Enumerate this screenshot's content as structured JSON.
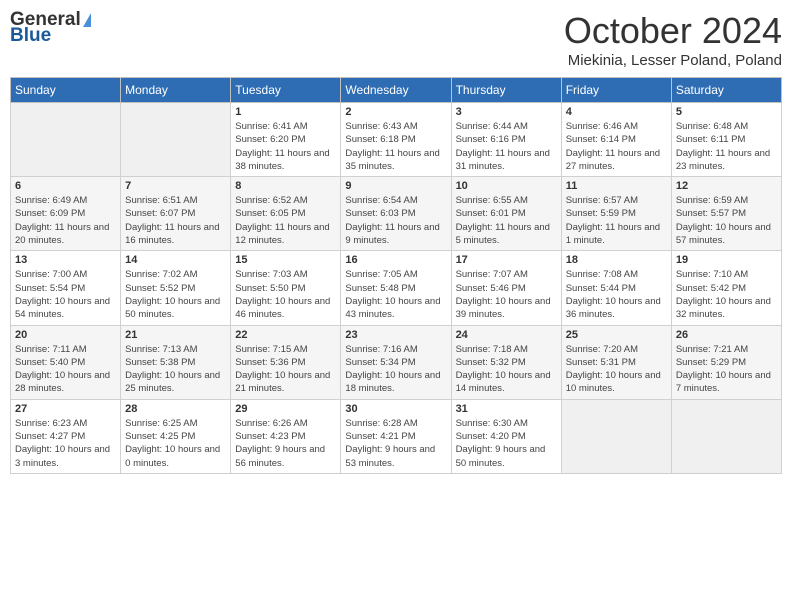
{
  "header": {
    "logo_general": "General",
    "logo_blue": "Blue",
    "month_title": "October 2024",
    "location": "Miekinia, Lesser Poland, Poland"
  },
  "days_of_week": [
    "Sunday",
    "Monday",
    "Tuesday",
    "Wednesday",
    "Thursday",
    "Friday",
    "Saturday"
  ],
  "weeks": [
    [
      {
        "day": "",
        "info": ""
      },
      {
        "day": "",
        "info": ""
      },
      {
        "day": "1",
        "info": "Sunrise: 6:41 AM\nSunset: 6:20 PM\nDaylight: 11 hours and 38 minutes."
      },
      {
        "day": "2",
        "info": "Sunrise: 6:43 AM\nSunset: 6:18 PM\nDaylight: 11 hours and 35 minutes."
      },
      {
        "day": "3",
        "info": "Sunrise: 6:44 AM\nSunset: 6:16 PM\nDaylight: 11 hours and 31 minutes."
      },
      {
        "day": "4",
        "info": "Sunrise: 6:46 AM\nSunset: 6:14 PM\nDaylight: 11 hours and 27 minutes."
      },
      {
        "day": "5",
        "info": "Sunrise: 6:48 AM\nSunset: 6:11 PM\nDaylight: 11 hours and 23 minutes."
      }
    ],
    [
      {
        "day": "6",
        "info": "Sunrise: 6:49 AM\nSunset: 6:09 PM\nDaylight: 11 hours and 20 minutes."
      },
      {
        "day": "7",
        "info": "Sunrise: 6:51 AM\nSunset: 6:07 PM\nDaylight: 11 hours and 16 minutes."
      },
      {
        "day": "8",
        "info": "Sunrise: 6:52 AM\nSunset: 6:05 PM\nDaylight: 11 hours and 12 minutes."
      },
      {
        "day": "9",
        "info": "Sunrise: 6:54 AM\nSunset: 6:03 PM\nDaylight: 11 hours and 9 minutes."
      },
      {
        "day": "10",
        "info": "Sunrise: 6:55 AM\nSunset: 6:01 PM\nDaylight: 11 hours and 5 minutes."
      },
      {
        "day": "11",
        "info": "Sunrise: 6:57 AM\nSunset: 5:59 PM\nDaylight: 11 hours and 1 minute."
      },
      {
        "day": "12",
        "info": "Sunrise: 6:59 AM\nSunset: 5:57 PM\nDaylight: 10 hours and 57 minutes."
      }
    ],
    [
      {
        "day": "13",
        "info": "Sunrise: 7:00 AM\nSunset: 5:54 PM\nDaylight: 10 hours and 54 minutes."
      },
      {
        "day": "14",
        "info": "Sunrise: 7:02 AM\nSunset: 5:52 PM\nDaylight: 10 hours and 50 minutes."
      },
      {
        "day": "15",
        "info": "Sunrise: 7:03 AM\nSunset: 5:50 PM\nDaylight: 10 hours and 46 minutes."
      },
      {
        "day": "16",
        "info": "Sunrise: 7:05 AM\nSunset: 5:48 PM\nDaylight: 10 hours and 43 minutes."
      },
      {
        "day": "17",
        "info": "Sunrise: 7:07 AM\nSunset: 5:46 PM\nDaylight: 10 hours and 39 minutes."
      },
      {
        "day": "18",
        "info": "Sunrise: 7:08 AM\nSunset: 5:44 PM\nDaylight: 10 hours and 36 minutes."
      },
      {
        "day": "19",
        "info": "Sunrise: 7:10 AM\nSunset: 5:42 PM\nDaylight: 10 hours and 32 minutes."
      }
    ],
    [
      {
        "day": "20",
        "info": "Sunrise: 7:11 AM\nSunset: 5:40 PM\nDaylight: 10 hours and 28 minutes."
      },
      {
        "day": "21",
        "info": "Sunrise: 7:13 AM\nSunset: 5:38 PM\nDaylight: 10 hours and 25 minutes."
      },
      {
        "day": "22",
        "info": "Sunrise: 7:15 AM\nSunset: 5:36 PM\nDaylight: 10 hours and 21 minutes."
      },
      {
        "day": "23",
        "info": "Sunrise: 7:16 AM\nSunset: 5:34 PM\nDaylight: 10 hours and 18 minutes."
      },
      {
        "day": "24",
        "info": "Sunrise: 7:18 AM\nSunset: 5:32 PM\nDaylight: 10 hours and 14 minutes."
      },
      {
        "day": "25",
        "info": "Sunrise: 7:20 AM\nSunset: 5:31 PM\nDaylight: 10 hours and 10 minutes."
      },
      {
        "day": "26",
        "info": "Sunrise: 7:21 AM\nSunset: 5:29 PM\nDaylight: 10 hours and 7 minutes."
      }
    ],
    [
      {
        "day": "27",
        "info": "Sunrise: 6:23 AM\nSunset: 4:27 PM\nDaylight: 10 hours and 3 minutes."
      },
      {
        "day": "28",
        "info": "Sunrise: 6:25 AM\nSunset: 4:25 PM\nDaylight: 10 hours and 0 minutes."
      },
      {
        "day": "29",
        "info": "Sunrise: 6:26 AM\nSunset: 4:23 PM\nDaylight: 9 hours and 56 minutes."
      },
      {
        "day": "30",
        "info": "Sunrise: 6:28 AM\nSunset: 4:21 PM\nDaylight: 9 hours and 53 minutes."
      },
      {
        "day": "31",
        "info": "Sunrise: 6:30 AM\nSunset: 4:20 PM\nDaylight: 9 hours and 50 minutes."
      },
      {
        "day": "",
        "info": ""
      },
      {
        "day": "",
        "info": ""
      }
    ]
  ]
}
